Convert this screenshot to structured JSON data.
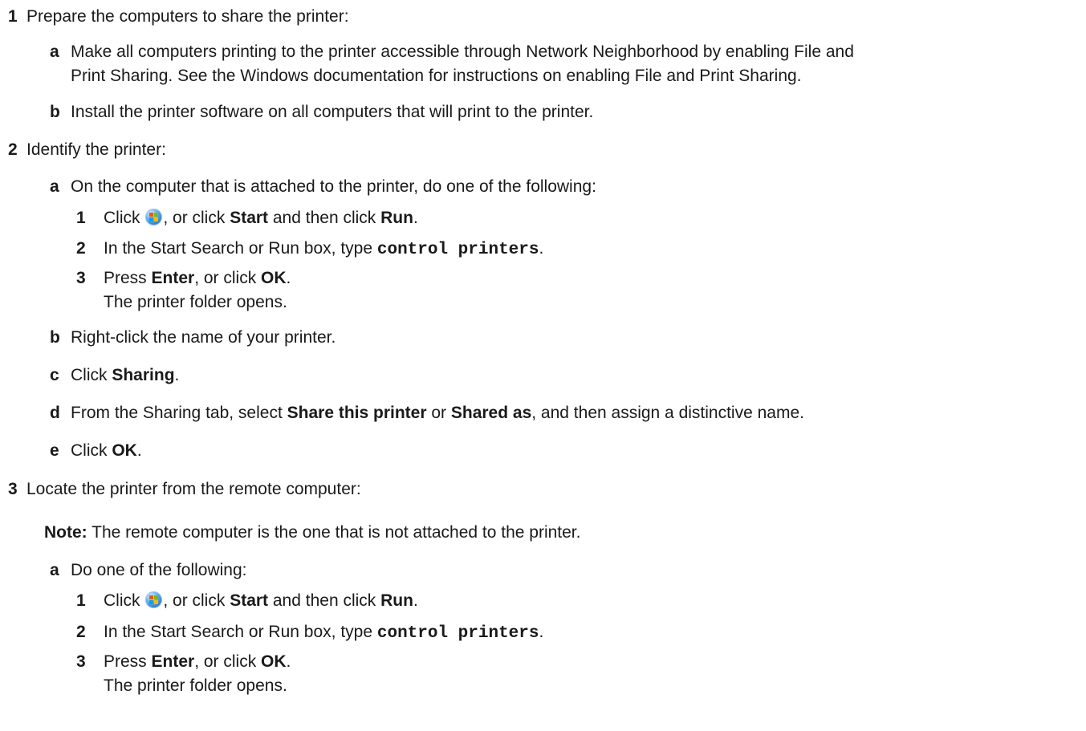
{
  "steps": {
    "s1": {
      "num": "1",
      "text": "Prepare the computers to share the printer:",
      "a": {
        "num": "a",
        "line1": "Make all computers printing to the printer accessible through Network Neighborhood by enabling File and",
        "line2": "Print Sharing. See the Windows documentation for instructions on enabling File and Print Sharing."
      },
      "b": {
        "num": "b",
        "text": "Install the printer software on all computers that will print to the printer."
      }
    },
    "s2": {
      "num": "2",
      "text": "Identify the printer:",
      "a": {
        "num": "a",
        "text": "On the computer that is attached to the printer, do one of the following:",
        "i1": {
          "num": "1",
          "t1": "Click ",
          "t2": ", or click ",
          "start": "Start",
          "t3": " and then click ",
          "run": "Run",
          "t4": "."
        },
        "i2": {
          "num": "2",
          "t1": "In the Start Search or Run box, type ",
          "cmd": "control printers",
          "t2": "."
        },
        "i3": {
          "num": "3",
          "t1": "Press ",
          "enter": "Enter",
          "t2": ", or click ",
          "ok": "OK",
          "t3": ".",
          "result": "The printer folder opens."
        }
      },
      "b": {
        "num": "b",
        "text": "Right-click the name of your printer."
      },
      "c": {
        "num": "c",
        "t1": "Click ",
        "bold": "Sharing",
        "t2": "."
      },
      "d": {
        "num": "d",
        "t1": "From the Sharing tab, select ",
        "bold1": "Share this printer",
        "t2": " or ",
        "bold2": "Shared as",
        "t3": ", and then assign a distinctive name."
      },
      "e": {
        "num": "e",
        "t1": "Click ",
        "bold": "OK",
        "t2": "."
      }
    },
    "s3": {
      "num": "3",
      "text": "Locate the printer from the remote computer:",
      "note_label": "Note:",
      "note_text": " The remote computer is the one that is not attached to the printer.",
      "a": {
        "num": "a",
        "text": "Do one of the following:",
        "i1": {
          "num": "1",
          "t1": "Click ",
          "t2": ", or click ",
          "start": "Start",
          "t3": " and then click ",
          "run": "Run",
          "t4": "."
        },
        "i2": {
          "num": "2",
          "t1": "In the Start Search or Run box, type ",
          "cmd": "control printers",
          "t2": "."
        },
        "i3": {
          "num": "3",
          "t1": "Press ",
          "enter": "Enter",
          "t2": ", or click ",
          "ok": "OK",
          "t3": ".",
          "result": "The printer folder opens."
        }
      }
    }
  },
  "icons": {
    "start_orb": "windows-start-orb-icon"
  }
}
